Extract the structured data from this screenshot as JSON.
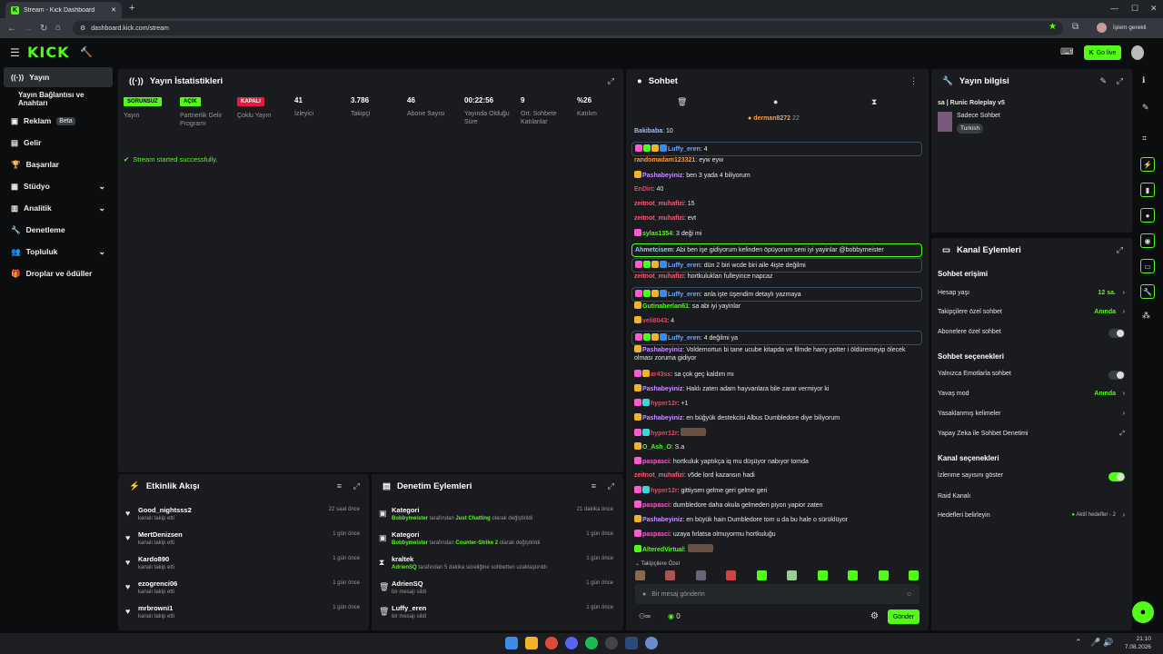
{
  "browser": {
    "tab_title": "Stream - Kick Dashboard",
    "url": "dashboard.kick.com/stream",
    "profile_label": "İşlem gerekli"
  },
  "header": {
    "logo": "KICK",
    "go_live": "Go live"
  },
  "sidebar": {
    "items": [
      {
        "label": "Yayın",
        "icon": "broadcast-icon"
      },
      {
        "label": "Yayın Bağlantısı ve Anahtarı",
        "icon": ""
      },
      {
        "label": "Reklam",
        "icon": "ad-icon",
        "badge": "Beta"
      },
      {
        "label": "Gelir",
        "icon": "wallet-icon"
      },
      {
        "label": "Başarılar",
        "icon": "trophy-icon"
      },
      {
        "label": "Stüdyo",
        "icon": "grid-icon"
      },
      {
        "label": "Analitik",
        "icon": "chart-icon"
      },
      {
        "label": "Denetleme",
        "icon": "wrench-icon"
      },
      {
        "label": "Topluluk",
        "icon": "community-icon"
      },
      {
        "label": "Droplar ve ödüller",
        "icon": "gift-icon"
      }
    ]
  },
  "stats": {
    "title": "Yayın İstatistikleri",
    "items": [
      {
        "tag": "SORUNSUZ",
        "label": "Yayın"
      },
      {
        "tag": "AÇIK",
        "label": "Partnerlik Gelir Programı"
      },
      {
        "tag": "KAPALI",
        "label": "Çoklu Yayın"
      },
      {
        "value": "41",
        "label": "İzleyici"
      },
      {
        "value": "3.786",
        "label": "Takipçi"
      },
      {
        "value": "46",
        "label": "Abone Sayısı"
      },
      {
        "value": "00:22:56",
        "label": "Yayında Olduğu Süre"
      },
      {
        "value": "9",
        "label": "Ort. Sohbete Katılanlar"
      },
      {
        "value": "%26",
        "label": "Katılım"
      }
    ],
    "success": "Stream started successfully."
  },
  "activity": {
    "title": "Etkinlik Akışı",
    "items": [
      {
        "name": "Good_nightsss2",
        "sub": "kanalı takip etti",
        "time": "22 saat önce"
      },
      {
        "name": "MertDenizsen",
        "sub": "kanalı takip etti",
        "time": "1 gün önce"
      },
      {
        "name": "Kardo890",
        "sub": "kanalı takip etti",
        "time": "1 gün önce"
      },
      {
        "name": "ezogrenci06",
        "sub": "kanalı takip etti",
        "time": "1 gün önce"
      },
      {
        "name": "mrbrowni1",
        "sub": "kanalı takip etti",
        "time": "1 gün önce"
      }
    ]
  },
  "moderation": {
    "title": "Denetim Eylemleri",
    "items": [
      {
        "name": "Kategori",
        "sub_user": "Bobbymeister",
        "sub_mid": " tarafından ",
        "sub_hl": "Just Chatting",
        "sub_end": " olarak değiştirildi",
        "time": "21 dakika önce"
      },
      {
        "name": "Kategori",
        "sub_user": "Bobbymeister",
        "sub_mid": " tarafından ",
        "sub_hl": "Counter-Strike 2",
        "sub_end": " olarak değiştirildi",
        "time": "1 gün önce"
      },
      {
        "name": "kraltek",
        "sub_user": "AdrienSQ",
        "sub_mid": " tarafından 5 dakika süreliğine sohbetten uzaklaştırıldı",
        "sub_hl": "",
        "sub_end": "",
        "time": "1 gün önce"
      },
      {
        "name": "AdrienSQ",
        "sub_user": "",
        "sub_mid": "bir mesajı sildi",
        "sub_hl": "",
        "sub_end": "",
        "time": "1 gün önce"
      },
      {
        "name": "Luffy_eren",
        "sub_user": "",
        "sub_mid": "bir mesajı sildi",
        "sub_hl": "",
        "sub_end": "",
        "time": "1 gün önce"
      }
    ]
  },
  "chat": {
    "title": "Sohbet",
    "pinned_user": "derman8272",
    "pinned_count": "22",
    "messages": [
      {
        "user": "Bakibaba",
        "color": "#8fc1ff",
        "text": "10"
      },
      {
        "user": "Luffy_eren",
        "color": "#6aa9ff",
        "text": "4"
      },
      {
        "user": "randomadam123321",
        "color": "#ff9a3c",
        "text": "eyw eyw"
      },
      {
        "user": "Pashabeyiniz",
        "color": "#c792ff",
        "text": "ben 3 yada 4 biliyorum"
      },
      {
        "user": "EnDiri",
        "color": "#ff3c5a",
        "text": "40"
      },
      {
        "user": "zeitnot_muhafizi",
        "color": "#ff5a6e",
        "text": "15"
      },
      {
        "user": "zeitnot_muhafizi",
        "color": "#ff5a6e",
        "text": "evt"
      },
      {
        "user": "sylas1354",
        "color": "#53fc18",
        "text": "3 deği mi"
      },
      {
        "user": "Ahmetcisem",
        "color": "#7fd6ff",
        "text": "Abi ben işe gidiyorum kelinden öpüyorum seni iyi yayinlar @bobbymeister"
      },
      {
        "user": "Luffy_eren",
        "color": "#6aa9ff",
        "text": "dün 2 biri wcde biri aile 4işte değilmi"
      },
      {
        "user": "zeitnot_muhafizi",
        "color": "#ff5a6e",
        "text": "hortkulukları fulleyince napcaz"
      },
      {
        "user": "Luffy_eren",
        "color": "#6aa9ff",
        "text": "anla işte üşendim detaylı yazmaya"
      },
      {
        "user": "Gutinaberlan61",
        "color": "#53fc18",
        "text": "sa abi iyi yayinlar"
      },
      {
        "user": "veli8043",
        "color": "#ff3c5a",
        "text": "4"
      },
      {
        "user": "Luffy_eren",
        "color": "#6aa9ff",
        "text": "4 değilmi ya"
      },
      {
        "user": "Pashabeyiniz",
        "color": "#c792ff",
        "text": "Voldemortun bi tane ucube kitapda ve filmde harry potter i öldüremeyip ölecek olması zoruma gidiyor"
      },
      {
        "user": "ar43ss",
        "color": "#ff3c5a",
        "text": "sa çok geç kaldım mı"
      },
      {
        "user": "Pashabeyiniz",
        "color": "#c792ff",
        "text": "Haklı zaten adam hayvanlara bile zarar vermiyor ki"
      },
      {
        "user": "hyper12r",
        "color": "#ff3c5a",
        "text": "+1"
      },
      {
        "user": "Pashabeyiniz",
        "color": "#c792ff",
        "text": "en büğyük destekcisi Albus Dumbledore diye biliyorum"
      },
      {
        "user": "hyper12r",
        "color": "#ff3c5a",
        "text": ""
      },
      {
        "user": "O_Ash_O",
        "color": "#53fc18",
        "text": "S.a"
      },
      {
        "user": "paspasci",
        "color": "#ff5ad2",
        "text": "hortkuluk yaptıkça iq mu düşüyor nabıyor tomda"
      },
      {
        "user": "zeitnot_muhafizi",
        "color": "#ff5a6e",
        "text": "v5de lord kazansın hadi"
      },
      {
        "user": "hyper12r",
        "color": "#ff3c5a",
        "text": "gittiysen gelme geri gelme geri"
      },
      {
        "user": "paspasci",
        "color": "#ff5ad2",
        "text": "dumbledore daha okula gelmeden piyon yapior zaten"
      },
      {
        "user": "Pashabeyiniz",
        "color": "#c792ff",
        "text": "en büyük hain Dumbledore tom u da bu hale o sürüklüyor"
      },
      {
        "user": "paspasci",
        "color": "#ff5ad2",
        "text": "uzaya fırlatsa olmuyormu hortkuluğu"
      },
      {
        "user": "AlteredVirtual",
        "color": "#53fc18",
        "text": ""
      }
    ],
    "emote_label": "Takipçilere Özel",
    "input_placeholder": "Bir mesaj gönderin",
    "points": "0",
    "send": "Gönder"
  },
  "stream_info": {
    "title": "Yayın bilgisi",
    "stream_title": "sa | Runic Roleplay v5",
    "category": "Sadece Sohbet",
    "language": "Turkish"
  },
  "channel_actions": {
    "title": "Kanal Eylemleri",
    "chat_access": "Sohbet erişimi",
    "account_age_label": "Hesap yaşı",
    "account_age_value": "12 sa.",
    "followers_only_label": "Takipçilere özel sohbet",
    "followers_only_value": "Anında",
    "subscribers_only_label": "Abonelere özel sohbet",
    "chat_options": "Sohbet seçenekleri",
    "emote_only_label": "Yalnızca Emotlarla sohbet",
    "slow_mode_label": "Yavaş mod",
    "slow_mode_value": "Anında",
    "banned_words_label": "Yasaklanmış kelimeler",
    "ai_moderation_label": "Yapay Zeka ile Sohbet Denetimi",
    "channel_options": "Kanal seçenekleri",
    "show_viewers_label": "İzlenme sayısını göster",
    "raid_label": "Raid Kanalı",
    "goals_label": "Hedefleri belirleyin",
    "goals_value": "Aktif hedefler - 2"
  },
  "taskbar": {
    "time": "21:10",
    "date": "7.08.2026"
  },
  "colors": {
    "accent": "#53fc18",
    "panel": "#191b1f",
    "bg": "#0b0d0f"
  }
}
